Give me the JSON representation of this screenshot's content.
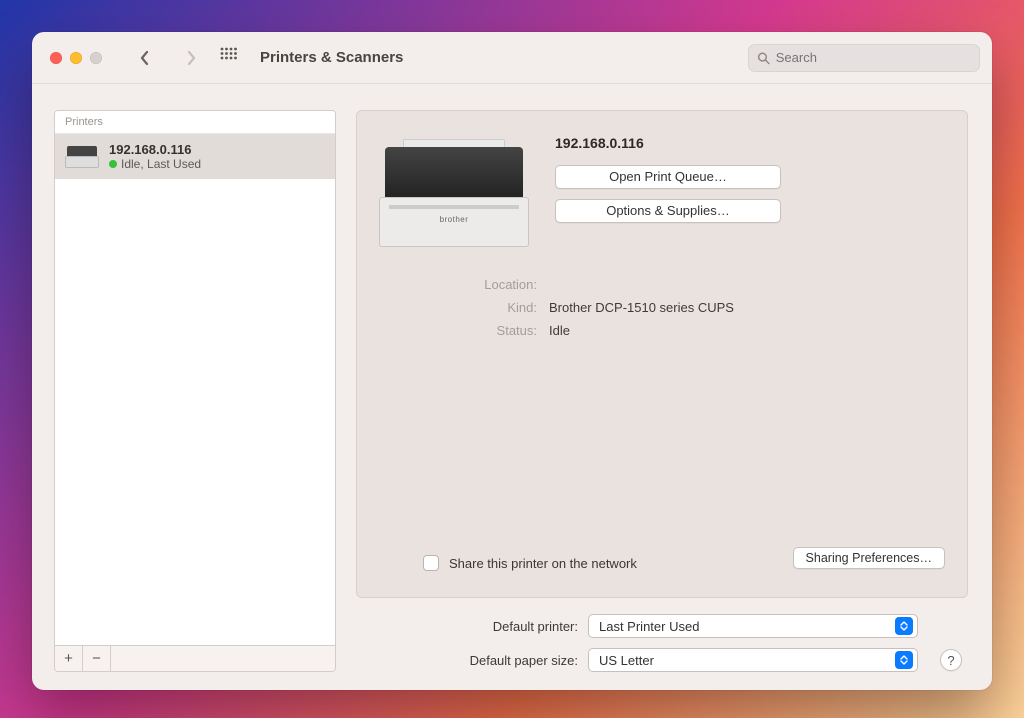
{
  "window": {
    "title": "Printers & Scanners",
    "search_placeholder": "Search"
  },
  "sidebar": {
    "header": "Printers",
    "items": [
      {
        "name": "192.168.0.116",
        "status": "Idle, Last Used"
      }
    ],
    "add_label": "+",
    "remove_label": "−"
  },
  "detail": {
    "title": "192.168.0.116",
    "brand": "brother",
    "open_queue_label": "Open Print Queue…",
    "options_supplies_label": "Options & Supplies…",
    "fields": {
      "location_key": "Location:",
      "location_val": "",
      "kind_key": "Kind:",
      "kind_val": "Brother DCP-1510 series CUPS",
      "status_key": "Status:",
      "status_val": "Idle"
    },
    "share_label": "Share this printer on the network",
    "sharing_prefs_label": "Sharing Preferences…"
  },
  "defaults": {
    "printer_label": "Default printer:",
    "printer_value": "Last Printer Used",
    "paper_label": "Default paper size:",
    "paper_value": "US Letter",
    "help": "?"
  }
}
